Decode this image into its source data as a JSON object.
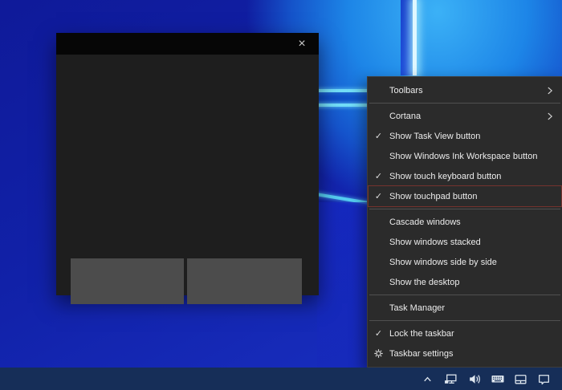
{
  "wallpaper": {
    "theme": "windows-10-hero",
    "base_dark_color": "#0f1a99",
    "base_bright_color": "#1a32c6",
    "glow_color": "#2ea6f2",
    "beam_color": "#72dcf8"
  },
  "touchpad_window": {
    "close_glyph": "×",
    "titlebar_color": "#060606",
    "body_color": "#1e1e1e",
    "button_color": "#4c4c4c"
  },
  "context_menu": {
    "background": "#2b2b2b",
    "text_color": "#ececec",
    "annotation_color": "#b23a32",
    "annotated_item": "Show touchpad button",
    "items": [
      {
        "label": "Toolbars",
        "has_submenu": true
      },
      {
        "label": "Cortana",
        "has_submenu": true
      },
      {
        "label": "Show Task View button",
        "checked": true,
        "check": "✓"
      },
      {
        "label": "Show Windows Ink Workspace button",
        "checked": false
      },
      {
        "label": "Show touch keyboard button",
        "checked": true,
        "check": "✓"
      },
      {
        "label": "Show touchpad button",
        "checked": true,
        "check": "✓",
        "annotated": true
      },
      {
        "label": "Cascade windows"
      },
      {
        "label": "Show windows stacked"
      },
      {
        "label": "Show windows side by side"
      },
      {
        "label": "Show the desktop"
      },
      {
        "label": "Task Manager"
      },
      {
        "label": "Lock the taskbar",
        "checked": true,
        "check": "✓"
      },
      {
        "label": "Taskbar settings",
        "icon": "gear"
      }
    ]
  },
  "taskbar": {
    "background": "#162e58",
    "tray_icons": [
      "hidden-icons-chevron",
      "network-icon",
      "volume-icon",
      "touch-keyboard-icon",
      "touchpad-icon",
      "action-center-icon"
    ]
  }
}
